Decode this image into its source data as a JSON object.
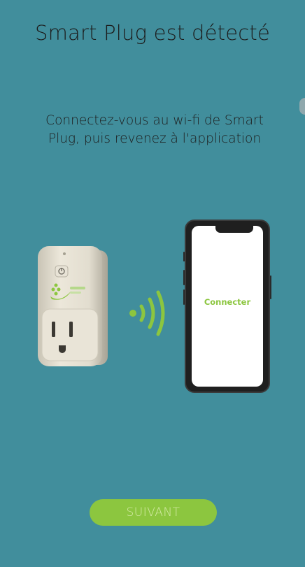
{
  "header": {
    "title": "Smart Plug est détecté"
  },
  "instructions": {
    "line1": "Connectez-vous au wi-fi de Smart",
    "line2": "Plug, puis revenez à l'application"
  },
  "illustration": {
    "plug_icon": "smart-plug-icon",
    "signal_icon": "wifi-signal-icon",
    "phone_icon": "smartphone-icon",
    "phone_screen_label": "Connecter"
  },
  "footer": {
    "next_label": "SUIVANT"
  },
  "colors": {
    "background": "#418e9c",
    "accent": "#8cc63f",
    "button_text": "#d3eaa4"
  }
}
